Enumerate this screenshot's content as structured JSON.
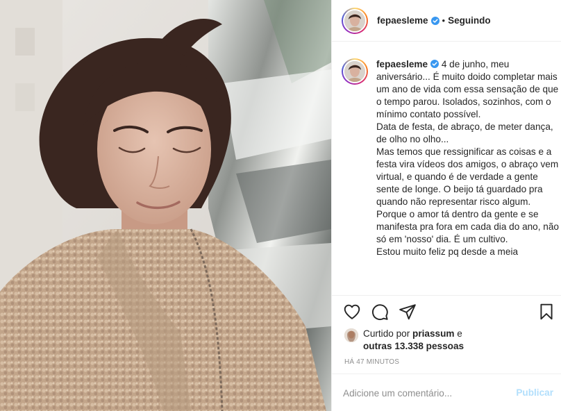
{
  "post": {
    "username": "fepaesleme",
    "follow_status": "Seguindo",
    "separator": "•",
    "caption": " 4 de junho, meu aniversário... É muito doido completar mais um ano de vida com essa sensação de que o tempo parou. Isolados, sozinhos, com o mínimo contato possível.\nData de festa, de abraço, de meter dança, de olho no olho...\nMas temos que ressignificar as coisas e a festa vira vídeos dos amigos, o abraço vem virtual, e quando é de verdade a gente sente de longe. O beijo tá guardado pra quando não representar risco algum. Porque o amor tá dentro da gente e se manifesta pra fora em cada dia do ano, não só em 'nosso' dia. É um cultivo.\nEstou muito feliz pq desde a meia",
    "liked_by_prefix": "Curtido por",
    "liked_by_user": "priassum",
    "liked_by_connector": "e",
    "liked_by_others": "outras 13.338 pessoas",
    "timestamp": "HÁ 47 MINUTOS"
  },
  "comment": {
    "placeholder": "Adicione um comentário...",
    "publish_label": "Publicar"
  },
  "icons": {
    "like": "heart-icon",
    "comment": "comment-icon",
    "share": "share-icon",
    "save": "bookmark-icon",
    "verified": "verified-badge-icon"
  },
  "colors": {
    "verified": "#3897f0",
    "publish_disabled": "#b2dffc",
    "muted_text": "#8e8e8e"
  }
}
